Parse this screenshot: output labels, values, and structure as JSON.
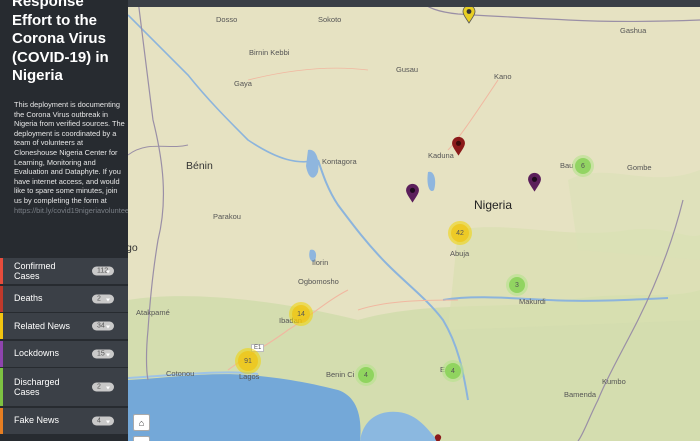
{
  "sidebar": {
    "title": "Response Effort to the Corona Virus (COVID-19) in Nigeria",
    "description": "This deployment is documenting the Corona Virus outbreak in Nigeria from verified sources. The deployment is coordinated by a team of volunteers at Cloneshouse Nigeria Center for Learning, Monitoring and Evaluation and Dataphyte. If you have internet access, and would like to spare some minutes, join us by completing the form at",
    "link": "https://bit.ly/covid19nigeriavolunteer",
    "categories": [
      {
        "label": "Confirmed Cases",
        "count": "112",
        "color": "#e74c3c"
      },
      {
        "label": "Deaths",
        "count": "2",
        "color": "#c0392b"
      },
      {
        "label": "Related News",
        "count": "34",
        "color": "#f1c40f"
      },
      {
        "label": "Lockdowns",
        "count": "15",
        "color": "#8e44ad"
      },
      {
        "label": "Discharged Cases",
        "count": "2",
        "color": "#7dc242"
      },
      {
        "label": "Fake News",
        "count": "4",
        "color": "#e67e22"
      }
    ]
  },
  "map": {
    "places": {
      "dosso": "Dosso",
      "sokoto": "Sokoto",
      "gashua": "Gashua",
      "birnin_kebbi": "Birnin Kebbi",
      "gaya": "Gaya",
      "gusau": "Gusau",
      "kano": "Kano",
      "kaduna": "Kaduna",
      "kontagora": "Kontagora",
      "bauchi": "Bau",
      "gombe": "Gombe",
      "benin_country": "Bénin",
      "nigeria": "Nigeria",
      "parakou": "Parakou",
      "abuja": "Abuja",
      "ilorin": "Ilorin",
      "ogbomosho": "Ogbomosho",
      "makurdi": "Makurdi",
      "atakpame": "Atakpamé",
      "ibadan": "Ibadan",
      "cotonou": "Cotonou",
      "lagos": "Lagos",
      "benin_city": "Benin Ci",
      "enugu": "E",
      "kumbo": "Kumbo",
      "bamenda": "Bamenda",
      "togo": "go",
      "road_e1": "E1"
    },
    "clusters": [
      {
        "count": "42",
        "type": "yellow"
      },
      {
        "count": "14",
        "type": "yellow"
      },
      {
        "count": "91",
        "type": "yellow"
      },
      {
        "count": "6",
        "type": "green"
      },
      {
        "count": "3",
        "type": "green"
      },
      {
        "count": "4",
        "type": "green"
      },
      {
        "count": "4",
        "type": "green"
      }
    ],
    "markers": [
      {
        "name": "related-news",
        "color": "#e8cf23"
      },
      {
        "name": "kaduna-death",
        "color": "#8b1a1a"
      },
      {
        "name": "lockdown-west",
        "color": "#5b1f5b"
      },
      {
        "name": "lockdown-east",
        "color": "#5b1f5b"
      },
      {
        "name": "bottom-marker",
        "color": "#8b1a1a"
      }
    ],
    "home_icon": "home-icon"
  }
}
